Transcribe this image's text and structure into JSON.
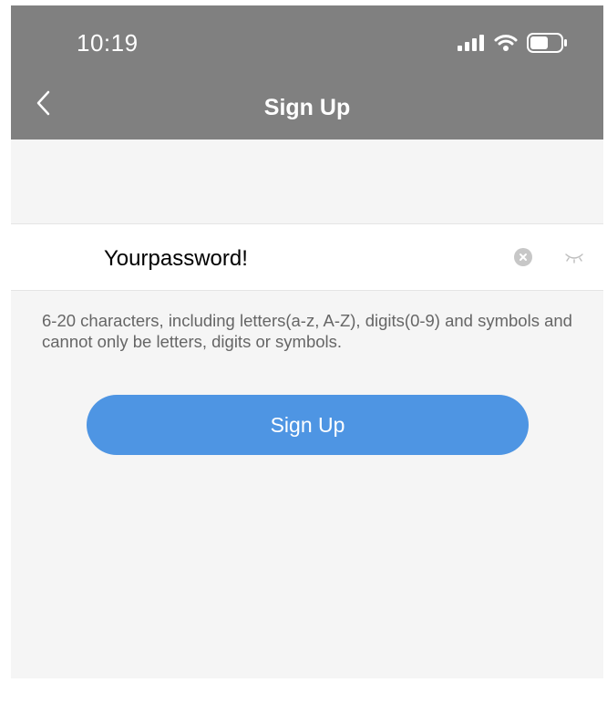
{
  "status_bar": {
    "time": "10:19",
    "icons": [
      "signal-icon",
      "wifi-icon",
      "battery-icon"
    ]
  },
  "nav": {
    "back_icon": "chevron-left-icon",
    "title": "Sign Up"
  },
  "password": {
    "value": "Yourpassword!",
    "clear_icon": "clear-icon",
    "visibility_icon": "eye-closed-icon"
  },
  "hint": "6-20 characters, including letters(a-z, A-Z), digits(0-9) and symbols and cannot only be letters, digits or symbols.",
  "submit": {
    "label": "Sign Up"
  },
  "colors": {
    "header_bg": "#808080",
    "page_bg": "#f5f5f5",
    "button_bg": "#4e95e3",
    "hint_text": "#666666"
  }
}
